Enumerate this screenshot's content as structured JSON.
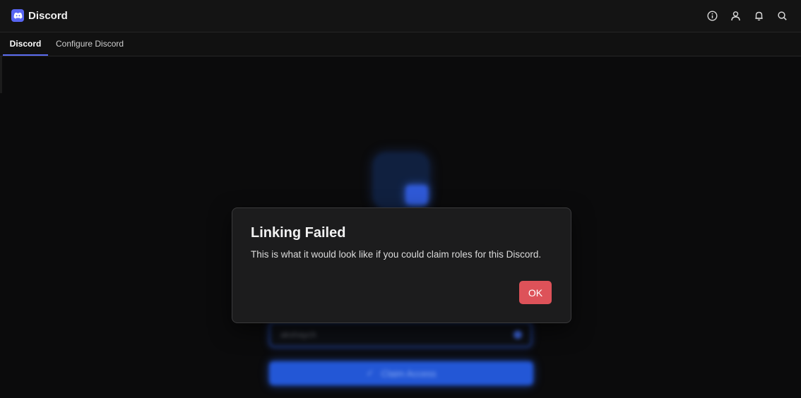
{
  "app": {
    "title": "Discord",
    "logo_icon": "discord-logo-icon",
    "accent_color": "#5865f2"
  },
  "top_actions": [
    {
      "icon": "info-icon"
    },
    {
      "icon": "user-icon"
    },
    {
      "icon": "bell-icon"
    },
    {
      "icon": "search-icon"
    }
  ],
  "tabs": [
    {
      "label": "Discord",
      "active": true
    },
    {
      "label": "Configure Discord",
      "active": false
    }
  ],
  "background": {
    "username_value": "akshaych",
    "claim_button_label": "Claim Access",
    "claim_icon": "check-icon"
  },
  "dialog": {
    "title": "Linking Failed",
    "message": "This is what it would look like if you could claim roles for this Discord.",
    "ok_label": "OK",
    "ok_color": "#dd5259"
  }
}
